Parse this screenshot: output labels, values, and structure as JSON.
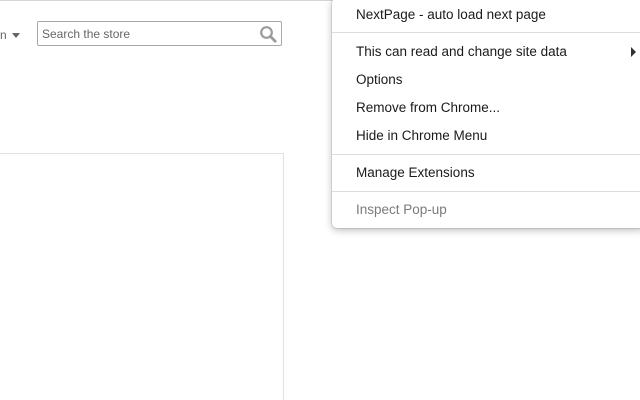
{
  "store_header": {
    "language_fragment": "n",
    "search": {
      "placeholder": "Search the store",
      "value": "",
      "icon": "magnifier"
    }
  },
  "context_menu": {
    "extension_title": "NextPage - auto load next page",
    "items": [
      {
        "label": "This can read and change site data",
        "has_submenu": true
      },
      {
        "label": "Options"
      },
      {
        "label": "Remove from Chrome..."
      },
      {
        "label": "Hide in Chrome Menu"
      }
    ],
    "manage_label": "Manage Extensions",
    "inspect_label": "Inspect Pop-up"
  }
}
